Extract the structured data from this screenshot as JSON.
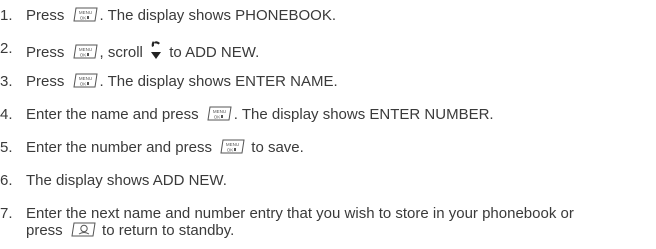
{
  "steps": [
    {
      "num": "1.",
      "before": "Press",
      "after": ". The display shows ",
      "display": "PHONEBOOK",
      "tail": "."
    },
    {
      "num": "2.",
      "before": "Press",
      "mid": ", scroll",
      "after": " to ",
      "display": "ADD NEW",
      "tail": "."
    },
    {
      "num": "3.",
      "before": "Press",
      "after": ". The display shows ",
      "display": "ENTER NAME",
      "tail": "."
    },
    {
      "num": "4.",
      "before": "Enter the name and press",
      "after": ". The display shows ",
      "display": "ENTER NUMBER",
      "tail": "."
    },
    {
      "num": "5.",
      "before": "Enter the number and press",
      "after": " to save."
    },
    {
      "num": "6.",
      "before": "The display shows ",
      "display": "ADD NEW",
      "tail": "."
    },
    {
      "num": "7.",
      "line1": "Enter the next name and number entry that you wish to store in your phonebook or",
      "before": "press",
      "after": " to return to standby."
    }
  ],
  "menu_key": {
    "top": "MENU",
    "bottom": "OK"
  }
}
